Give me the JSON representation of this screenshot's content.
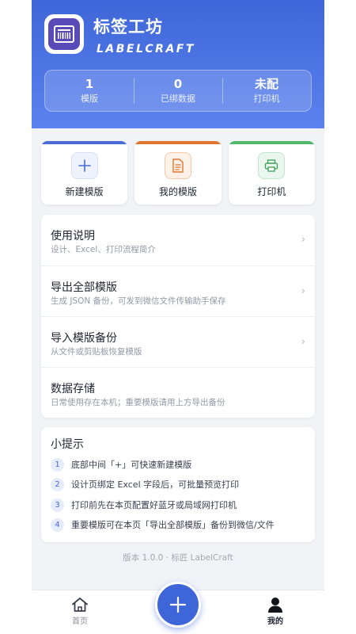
{
  "header": {
    "app_name": "标签工坊",
    "app_subtitle": "LABELCRAFT",
    "logo_icon": "barcode-label-icon",
    "stats": [
      {
        "value": "1",
        "label": "模版"
      },
      {
        "value": "0",
        "label": "已绑数据"
      },
      {
        "value": "未配",
        "label": "打印机"
      }
    ]
  },
  "quick_actions": [
    {
      "label": "新建模版",
      "icon": "plus-icon",
      "accent": "#4a6ad6"
    },
    {
      "label": "我的模版",
      "icon": "document-icon",
      "accent": "#e0772f"
    },
    {
      "label": "打印机",
      "icon": "printer-icon",
      "accent": "#4fb86b"
    }
  ],
  "menu": [
    {
      "title": "使用说明",
      "desc": "设计、Excel、打印流程简介",
      "chevron": true
    },
    {
      "title": "导出全部模版",
      "desc": "生成 JSON 备份，可发到微信文件传输助手保存",
      "chevron": true
    },
    {
      "title": "导入模版备份",
      "desc": "从文件或剪贴板恢复模版",
      "chevron": true
    },
    {
      "title": "数据存储",
      "desc": "日常使用存在本机；重要模版请用上方导出备份",
      "chevron": false
    }
  ],
  "tips": {
    "title": "小提示",
    "items": [
      {
        "num": "1",
        "text": "底部中间「+」可快速新建模版"
      },
      {
        "num": "2",
        "text": "设计页绑定 Excel 字段后，可批量预览打印"
      },
      {
        "num": "3",
        "text": "打印前先在本页配置好蓝牙或局域网打印机"
      },
      {
        "num": "4",
        "text": "重要模版可在本页「导出全部模版」备份到微信/文件"
      }
    ]
  },
  "version": "版本 1.0.0 · 标匠 LabelCraft",
  "tabbar": {
    "home_label": "首页",
    "mine_label": "我的",
    "active_tab": "我的",
    "colors": {
      "active": "#1f2430",
      "inactive": "#8a8f9a",
      "primary": "#3f66d8"
    }
  }
}
